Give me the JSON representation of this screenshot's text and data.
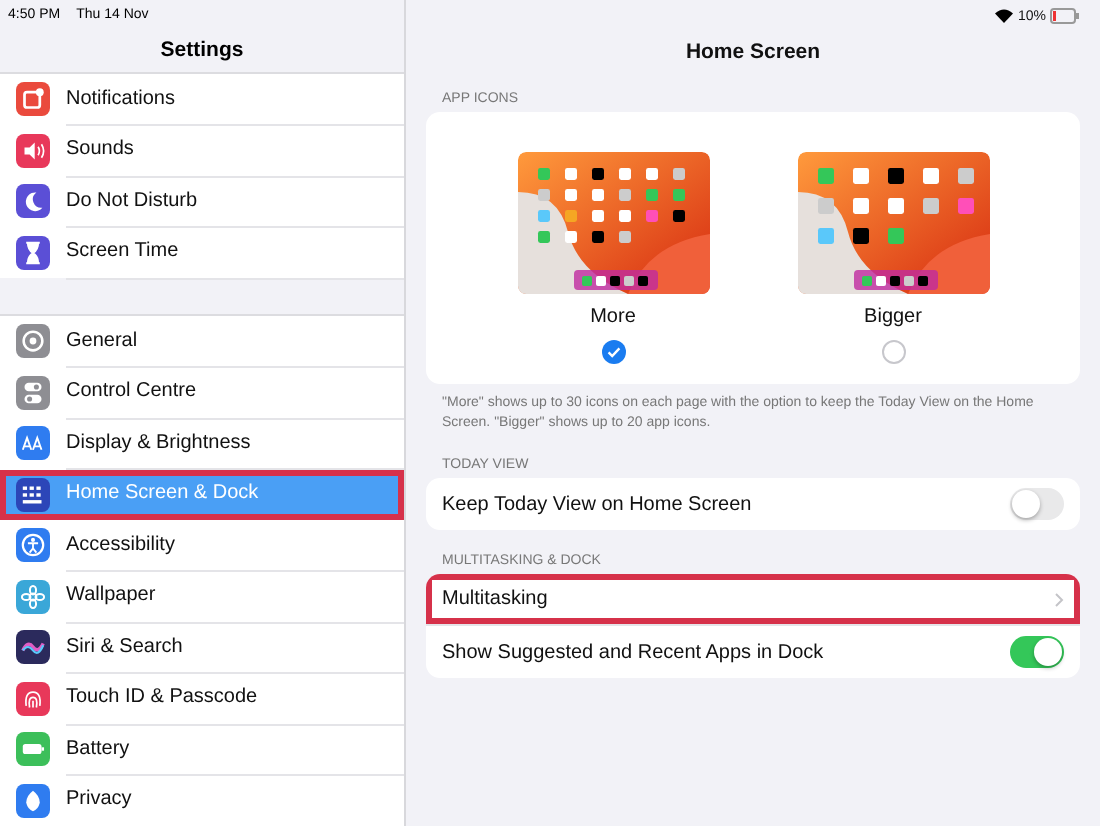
{
  "status_bar": {
    "time": "4:50 PM",
    "date": "Thu 14 Nov",
    "battery": "10%"
  },
  "sidebar": {
    "title": "Settings",
    "groups": [
      {
        "items": [
          {
            "label": "Notifications",
            "color": "#ea4a3d",
            "selected": false,
            "highlighted": false
          },
          {
            "label": "Sounds",
            "color": "#e8385a",
            "selected": false,
            "highlighted": false
          },
          {
            "label": "Do Not Disturb",
            "color": "#5b4fd6",
            "selected": false,
            "highlighted": false
          },
          {
            "label": "Screen Time",
            "color": "#5b4fd6",
            "selected": false,
            "highlighted": false
          }
        ]
      },
      {
        "items": [
          {
            "label": "General",
            "color": "#8e8e93",
            "selected": false,
            "highlighted": false
          },
          {
            "label": "Control Centre",
            "color": "#8e8e93",
            "selected": false,
            "highlighted": false
          },
          {
            "label": "Display & Brightness",
            "color": "#2f7cf0",
            "selected": false,
            "highlighted": false
          },
          {
            "label": "Home Screen & Dock",
            "color": "#2c46b8",
            "selected": true,
            "highlighted": true
          },
          {
            "label": "Accessibility",
            "color": "#2f7cf0",
            "selected": false,
            "highlighted": false
          },
          {
            "label": "Wallpaper",
            "color": "#3aa7d8",
            "selected": false,
            "highlighted": false
          },
          {
            "label": "Siri & Search",
            "color": "#2b2a5c",
            "selected": false,
            "highlighted": false
          },
          {
            "label": "Touch ID & Passcode",
            "color": "#e8385a",
            "selected": false,
            "highlighted": false
          },
          {
            "label": "Battery",
            "color": "#3cbf5a",
            "selected": false,
            "highlighted": false
          },
          {
            "label": "Privacy",
            "color": "#2f7cf0",
            "selected": false,
            "highlighted": false
          }
        ]
      }
    ]
  },
  "detail": {
    "title": "Home Screen",
    "app_icons": {
      "header": "APP ICONS",
      "options": [
        {
          "label": "More",
          "selected": true
        },
        {
          "label": "Bigger",
          "selected": false
        }
      ],
      "footnote": "\"More\" shows up to 30 icons on each page with the option to keep the Today View on the Home Screen. \"Bigger\" shows up to 20 app icons."
    },
    "sections": [
      {
        "header": "TODAY VIEW",
        "rows": [
          {
            "kind": "toggle",
            "label": "Keep Today View on Home Screen",
            "on": false,
            "highlighted": false
          }
        ]
      },
      {
        "header": "MULTITASKING & DOCK",
        "rows": [
          {
            "kind": "link",
            "label": "Multitasking",
            "highlighted": true
          },
          {
            "kind": "toggle",
            "label": "Show Suggested and Recent Apps in Dock",
            "on": true,
            "highlighted": false
          }
        ]
      }
    ]
  }
}
